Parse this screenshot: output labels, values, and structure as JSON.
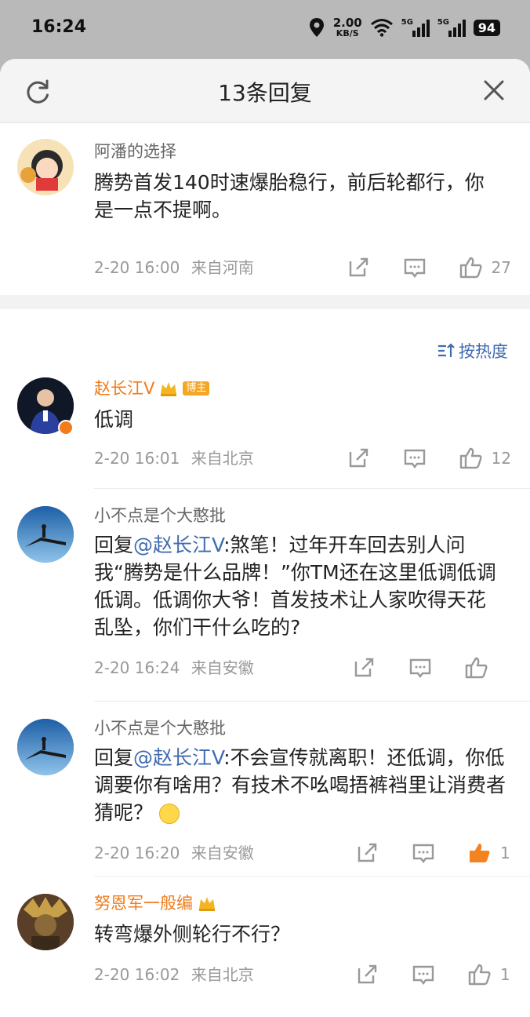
{
  "status_bar": {
    "time": "16:24",
    "speed_value": "2.00",
    "speed_unit": "KB/S",
    "network1": "5G",
    "network2": "5G",
    "battery": "94"
  },
  "sheet": {
    "title": "13条回复"
  },
  "original_comment": {
    "username": "阿潘的选择",
    "text": "腾势首发140时速爆胎稳行，前后轮都行，你是一点不提啊。",
    "time": "2-20 16:00",
    "location": "来自河南",
    "likes": "27"
  },
  "sort_label": "按热度",
  "replies": [
    {
      "username": "赵长江V",
      "badge": "博主",
      "text": "低调",
      "time": "2-20 16:01",
      "location": "来自北京",
      "likes": "12"
    },
    {
      "username": "小不点是个大憨批",
      "reply_prefix": "回复",
      "mention": "@赵长江V",
      "text": ":煞笔！过年开车回去别人问我“腾势是什么品牌！”你TM还在这里低调低调低调。低调你大爷！首发技术让人家吹得天花乱坠，你们干什么吃的?",
      "time": "2-20 16:24",
      "location": "来自安徽",
      "likes": ""
    },
    {
      "username": "小不点是个大憨批",
      "reply_prefix": "回复",
      "mention": "@赵长江V",
      "text": ":不会宣传就离职！还低调，你低调要你有啥用？有技术不吆喝捂裤裆里让消费者猜呢？",
      "time": "2-20 16:20",
      "location": "来自安徽",
      "likes": "1"
    },
    {
      "username": "努恩军一般编",
      "text": "转弯爆外侧轮行不行？",
      "time": "2-20 16:02",
      "location": "来自北京",
      "likes": "1"
    }
  ],
  "colors": {
    "accent_orange": "#f27b1a",
    "link_blue": "#3f6bb0",
    "liked_orange": "#f58220"
  },
  "icons": [
    "refresh-icon",
    "close-icon",
    "share-icon",
    "comment-icon",
    "like-icon",
    "crown-icon",
    "sort-icon",
    "smile-emoji"
  ]
}
